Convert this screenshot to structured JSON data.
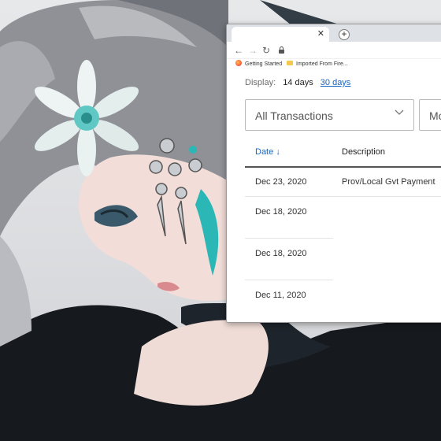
{
  "browser": {
    "tab": {
      "close_glyph": "✕",
      "new_tab_glyph": "+"
    },
    "toolbar": {
      "back_glyph": "←",
      "forward_glyph": "→",
      "reload_glyph": "↻"
    },
    "bookmarks": [
      {
        "label": "Getting Started",
        "icon": "firefox-icon"
      },
      {
        "label": "Imported From Fire...",
        "icon": "folder-icon"
      }
    ]
  },
  "page": {
    "display": {
      "label": "Display:",
      "option_14": "14 days",
      "option_30": "30 days"
    },
    "filters": {
      "transactions_select": "All Transactions",
      "second_select": "Mo"
    },
    "table": {
      "columns": {
        "date": "Date",
        "date_sort_glyph": "↓",
        "description": "Description"
      },
      "rows": [
        {
          "date": "Dec 23, 2020",
          "description": "Prov/Local Gvt Payment"
        },
        {
          "date": "Dec 18, 2020",
          "description": ""
        },
        {
          "date": "Dec 18, 2020",
          "description": ""
        },
        {
          "date": "Dec 11, 2020",
          "description": ""
        }
      ]
    }
  },
  "colors": {
    "link": "#1565c0",
    "tabstrip": "#dee1e6",
    "wallpaper_accent": "#2ab7b5"
  }
}
